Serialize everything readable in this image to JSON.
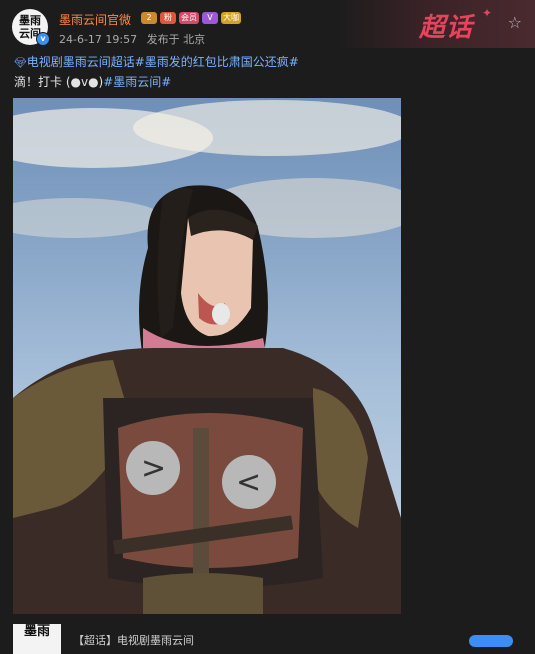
{
  "header": {
    "avatar_text_line1": "墨雨",
    "avatar_text_line2": "云间",
    "account_name": "墨雨云间官微",
    "date": "24-6-17 19:57",
    "source": "发布于 北京",
    "banner_text": "超话",
    "badges": [
      "2",
      "粉",
      "会员",
      "V",
      "大咖"
    ]
  },
  "post": {
    "topic_1": "电视剧墨雨云间超话",
    "topic_2": "#墨雨发的红包比肃国公还疯#",
    "line2_plain": "滴！打卡 (●v●)",
    "topic_3": "#墨雨云间#"
  },
  "bottom_card": {
    "avatar_text": "墨雨",
    "title": "【超话】电视剧墨雨云间"
  },
  "icons": {
    "star": "star-icon",
    "diamond": "diamond-icon",
    "verified": "verified-badge-icon"
  },
  "colors": {
    "accent_orange": "#ff8a3d",
    "topic_blue": "#7ab2ff",
    "chaohua_red": "#e6445a",
    "background": "#1c1c1c"
  }
}
